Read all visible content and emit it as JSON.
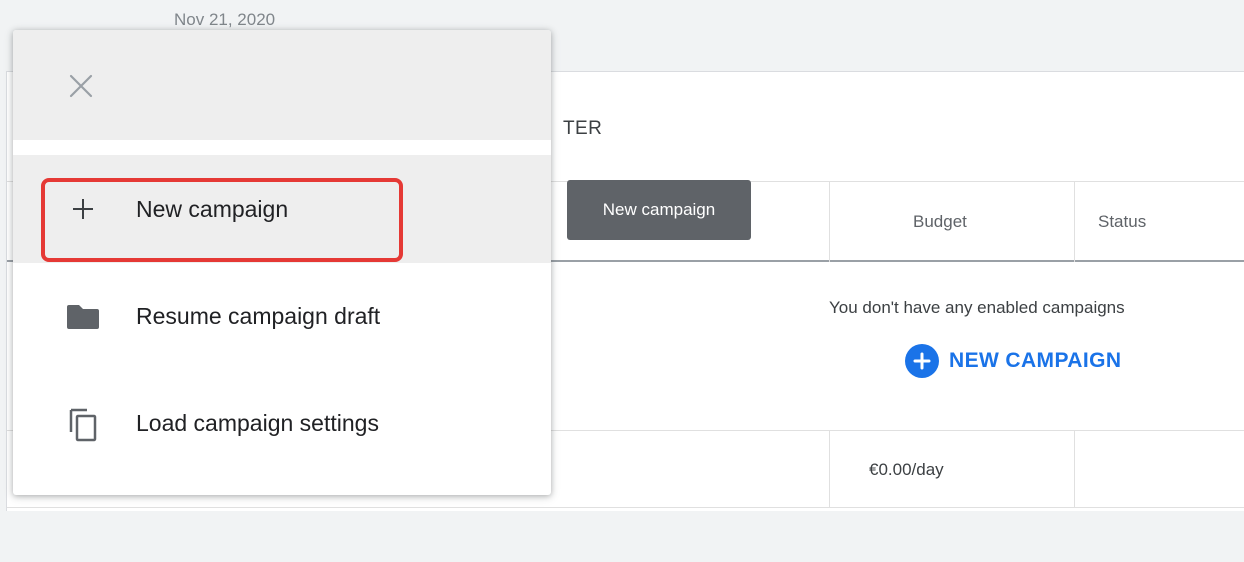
{
  "header": {
    "date_range": "Nov 21, 2020"
  },
  "table": {
    "filter_label": "TER",
    "columns": {
      "budget": "Budget",
      "status": "Status"
    },
    "empty_message": "You don't have any enabled campaigns",
    "new_campaign_link": "NEW CAMPAIGN",
    "total_budget": "€0.00/day"
  },
  "tooltip": {
    "text": "New campaign"
  },
  "menu": {
    "items": [
      {
        "label": "New campaign",
        "icon": "plus-icon",
        "highlighted": true
      },
      {
        "label": "Resume campaign draft",
        "icon": "folder-icon"
      },
      {
        "label": "Load campaign settings",
        "icon": "copy-icon"
      }
    ]
  },
  "colors": {
    "accent": "#1a73e8",
    "highlight": "#e53935",
    "tooltip_bg": "#5f6368"
  }
}
